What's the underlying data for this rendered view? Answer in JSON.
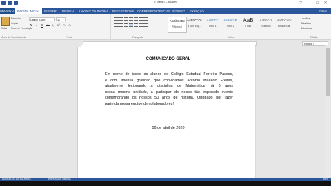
{
  "window": {
    "title": "Carta1 - Word",
    "controls": [
      "?",
      "—",
      "□",
      "✕"
    ]
  },
  "tabs": {
    "file": "ARQUIVO",
    "items": [
      "PÁGINA INICIAL",
      "INSERIR",
      "DESIGN",
      "LAYOUT DA PÁGINA",
      "REFERÊNCIAS",
      "CORRESPONDÊNCIAS",
      "REVISÃO",
      "EXIBIÇÃO"
    ],
    "signin": "Entrar"
  },
  "ribbon": {
    "clipboard": {
      "paste": "Colar",
      "cut": "Recortar",
      "copy": "Copiar",
      "painter": "Pincel de Formatação",
      "label": "Área de Transferência"
    },
    "font": {
      "name": "Calibri (Corp",
      "size": "11",
      "label": "Fonte",
      "buttons": [
        "N",
        "I",
        "S",
        "abc",
        "x₂",
        "x²",
        "A",
        "A"
      ]
    },
    "paragraph": {
      "label": "Parágrafo"
    },
    "styles": {
      "label": "Estilos",
      "items": [
        {
          "sample": "AaBbCcDc",
          "name": "¶ Normal"
        },
        {
          "sample": "AaBbCcDc",
          "name": "¶ Sem Esp..."
        },
        {
          "sample": "AaBbCc",
          "name": "Título 1"
        },
        {
          "sample": "AaBbCcE",
          "name": "Título 2"
        },
        {
          "sample": "AaB",
          "name": "Título"
        },
        {
          "sample": "AaBbCcL",
          "name": "Subtítulo"
        },
        {
          "sample": "AaBbCcDi",
          "name": "Ênfase Sutil"
        }
      ]
    },
    "editing": {
      "find": "Localizar",
      "replace": "Substituir",
      "select": "Selecionar",
      "label": "Edição"
    }
  },
  "search_pane": {
    "placeholder": "Página 1"
  },
  "document": {
    "title": "COMUNICADO GERAL",
    "lines": [
      "Em nome de todos os alunos do Colégio Estadual Ferreira Passos,",
      "é com imensa gratidão que convidamos Antônio Macedo Freitas,",
      "atualmente lecionando a disciplina de Matemática há 6 anos",
      "nessa mesma unidade, a participar do nosso tão esperado evento",
      "comemorando os nossos 50 anos de história. Obrigado por fazer",
      "parte da nossa equipe de colaboradores!"
    ],
    "date": "06 de abril de 2020"
  },
  "status": {
    "left": "PÁGINA 1 DE 1   43 PALAVRAS",
    "language": "PORTUGUÊS (BRASIL)",
    "zoom": "100%"
  },
  "colors": {
    "accent": "#2b579a"
  }
}
